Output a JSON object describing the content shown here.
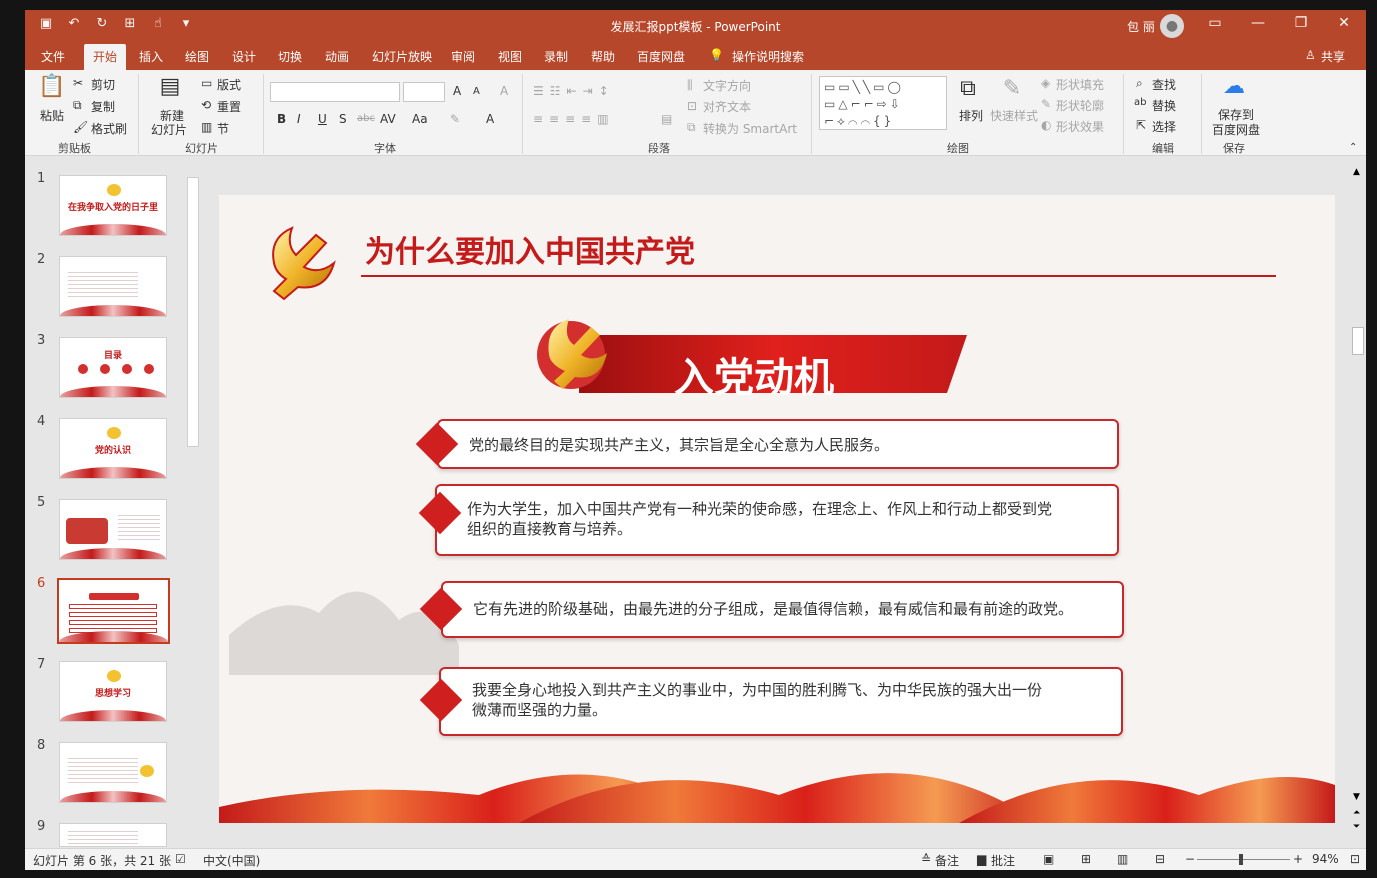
{
  "app": {
    "doc_title": "发展汇报ppt模板 - PowerPoint",
    "user_name": "包 丽",
    "avatar_icon": "person",
    "window_controls": [
      "ribbon-display-icon",
      "minimize-icon",
      "restore-icon",
      "close-icon"
    ]
  },
  "menu": {
    "tabs": [
      "文件",
      "开始",
      "插入",
      "绘图",
      "设计",
      "切换",
      "动画",
      "幻灯片放映",
      "审阅",
      "视图",
      "录制",
      "帮助",
      "百度网盘"
    ],
    "active_tab": "开始",
    "tell_me": "操作说明搜索",
    "share": "共享"
  },
  "ribbon": {
    "clipboard": {
      "paste": "粘贴",
      "cut": "剪切",
      "copy": "复制",
      "format_painter": "格式刷",
      "group": "剪贴板"
    },
    "slides": {
      "new_slide_1": "新建",
      "new_slide_2": "幻灯片",
      "layout": "版式",
      "reset": "重置",
      "section": "节",
      "group": "幻灯片"
    },
    "font": {
      "group": "字体",
      "bold": "B",
      "italic": "I",
      "underline": "U",
      "shadow": "S",
      "strike": "abc",
      "spacing": "AV",
      "case": "Aa",
      "grow": "A",
      "shrink": "A",
      "clear": "A",
      "color": "A"
    },
    "paragraph": {
      "group": "段落",
      "text_direction": "文字方向",
      "align_text": "对齐文本",
      "smartart": "转换为 SmartArt"
    },
    "drawing": {
      "group": "绘图",
      "arrange": "排列",
      "quick_styles": "快速样式",
      "fill": "形状填充",
      "outline": "形状轮廓",
      "effects": "形状效果",
      "shapes_glyphs": "▭▭╲╲▭◯\n▭△⌐⌐⇨⇩\n⌐⟡⌒⌒{}"
    },
    "editing": {
      "group": "编辑",
      "find": "查找",
      "replace": "替换",
      "select": "选择"
    },
    "save": {
      "group": "保存",
      "line1": "保存到",
      "line2": "百度网盘"
    }
  },
  "thumbnails": [
    {
      "num": "1",
      "label": "在我争取入党的日子里"
    },
    {
      "num": "2",
      "label": ""
    },
    {
      "num": "3",
      "label": "目录"
    },
    {
      "num": "4",
      "label": "党的认识"
    },
    {
      "num": "5",
      "label": ""
    },
    {
      "num": "6",
      "label": ""
    },
    {
      "num": "7",
      "label": "思想学习"
    },
    {
      "num": "8",
      "label": ""
    },
    {
      "num": "9",
      "label": ""
    }
  ],
  "selected_slide": "6",
  "slide": {
    "title": "为什么要加入中国共产党",
    "banner": "入党动机",
    "colors": {
      "red": "#c41a1a",
      "gold": "#f0b429"
    },
    "items": [
      "党的最终目的是实现共产主义，其宗旨是全心全意为人民服务。",
      "作为大学生，加入中国共产党有一种光荣的使命感，在理念上、作风上和行动上都受到党组织的直接教育与培养。",
      "它有先进的阶级基础，由最先进的分子组成，是最值得信赖，最有威信和最有前途的政党。",
      "我要全身心地投入到共产主义的事业中，为中国的胜利腾飞、为中华民族的强大出一份微薄而坚强的力量。"
    ],
    "item_lines": [
      [
        "党的最终目的是实现共产主义，其宗旨是全心全意为人民服务。"
      ],
      [
        "作为大学生，加入中国共产党有一种光荣的使命感，在理念上、作风上和行动上都受到党",
        "组织的直接教育与培养。"
      ],
      [
        "它有先进的阶级基础，由最先进的分子组成，是最值得信赖，最有威信和最有前途的政党。"
      ],
      [
        "我要全身心地投入到共产主义的事业中，为中国的胜利腾飞、为中华民族的强大出一份",
        "微薄而坚强的力量。"
      ]
    ]
  },
  "status": {
    "slide_info": "幻灯片 第 6 张，共 21 张",
    "language": "中文(中国)",
    "notes": "备注",
    "comments": "批注",
    "zoom": "94%"
  }
}
